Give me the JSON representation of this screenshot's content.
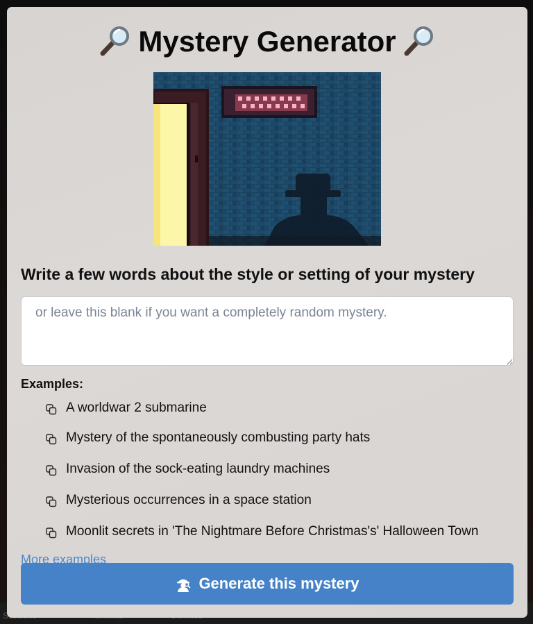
{
  "app": {
    "title": "Mystery Generator",
    "title_icon": "magnifying-glass-icon"
  },
  "hero_image": {
    "description_icon": "pixel-art-detective-alley",
    "colors": {
      "wall": "#1e4a66",
      "door_light": "#fcf6a8",
      "sign": "#c95a6e",
      "silhouette": "#0f1d2b"
    }
  },
  "form": {
    "prompt_label": "Write a few words about the style or setting of your mystery",
    "input_value": "",
    "input_placeholder": "or leave this blank if you want a completely random mystery."
  },
  "examples": {
    "label": "Examples:",
    "items": [
      {
        "label": "A worldwar 2 submarine",
        "icon": "copy-icon"
      },
      {
        "label": "Mystery of the spontaneously combusting party hats",
        "icon": "copy-icon"
      },
      {
        "label": "Invasion of the sock-eating laundry machines",
        "icon": "copy-icon"
      },
      {
        "label": "Mysterious occurrences in a space station",
        "icon": "copy-icon"
      },
      {
        "label": "Moonlit secrets in 'The Nightmare Before Christmas's' Halloween Town",
        "icon": "copy-icon"
      }
    ],
    "more_link": "More examples"
  },
  "actions": {
    "generate_label": "Generate this mystery",
    "generate_icon": "detective-icon"
  },
  "taskbar": {
    "items": [
      "Sessions",
      "Terminal",
      "Services"
    ]
  },
  "colors": {
    "accent": "#4582c8",
    "link": "#4a89cf",
    "card_bg": "#d9d5d3"
  }
}
